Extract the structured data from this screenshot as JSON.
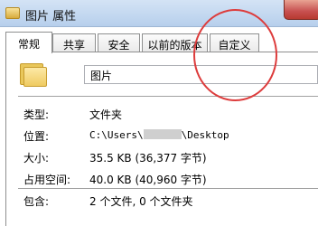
{
  "window": {
    "title": "图片 属性",
    "close_icon": "close-icon"
  },
  "tabs": [
    {
      "label": "常规",
      "active": true
    },
    {
      "label": "共享",
      "active": false
    },
    {
      "label": "安全",
      "active": false
    },
    {
      "label": "以前的版本",
      "active": false
    },
    {
      "label": "自定义",
      "active": false
    }
  ],
  "general": {
    "folder_icon": "folder-icon",
    "name_value": "图片",
    "type": {
      "label": "类型:",
      "value": "文件夹"
    },
    "location": {
      "label": "位置:",
      "value_prefix": "C:\\Users\\",
      "value_suffix": "\\Desktop"
    },
    "size": {
      "label": "大小:",
      "value": "35.5 KB (36,377 字节)"
    },
    "size_on_disk": {
      "label": "占用空间:",
      "value": "40.0 KB (40,960 字节)"
    },
    "contains": {
      "label": "包含:",
      "value": "2 个文件, 0 个文件夹"
    }
  },
  "annotation": {
    "color": "#dd3c3c"
  }
}
